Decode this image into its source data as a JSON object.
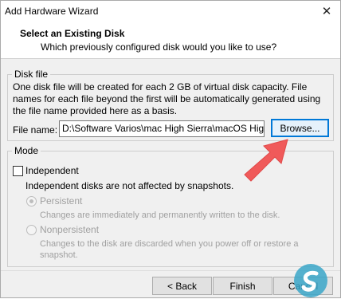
{
  "window": {
    "title": "Add Hardware Wizard",
    "close_glyph": "✕"
  },
  "header": {
    "title": "Select an Existing Disk",
    "subtitle": "Which previously configured disk would you like to use?"
  },
  "disk_file": {
    "legend": "Disk file",
    "description": "One disk file will be created for each 2 GB of virtual disk capacity. File names for each file beyond the first will be automatically generated using the file name provided here as a basis.",
    "file_name_label": "File name:",
    "file_name_value": "D:\\Software Varios\\mac High Sierra\\macOS High Sier",
    "browse_label": "Browse..."
  },
  "mode": {
    "legend": "Mode",
    "independent": {
      "label": "Independent",
      "checked": false,
      "description": "Independent disks are not affected by snapshots."
    },
    "persistent": {
      "label": "Persistent",
      "selected": true,
      "enabled": false,
      "description": "Changes are immediately and permanently written to the disk."
    },
    "nonpersistent": {
      "label": "Nonpersistent",
      "selected": false,
      "enabled": false,
      "description_line1": "Changes to the disk are discarded when you power off or restore a",
      "description_line2": "snapshot."
    }
  },
  "footer": {
    "back_label": "< Back",
    "finish_label": "Finish",
    "cancel_label": "Cancel"
  },
  "colors": {
    "arrow": "#f05a5a",
    "focus_border": "#0078d7",
    "disabled_text": "#a0a0a0",
    "watermark": "#3aa6c8"
  },
  "icons": {
    "pointer_arrow": "annotation-arrow-icon",
    "watermark": "site-logo-icon"
  }
}
